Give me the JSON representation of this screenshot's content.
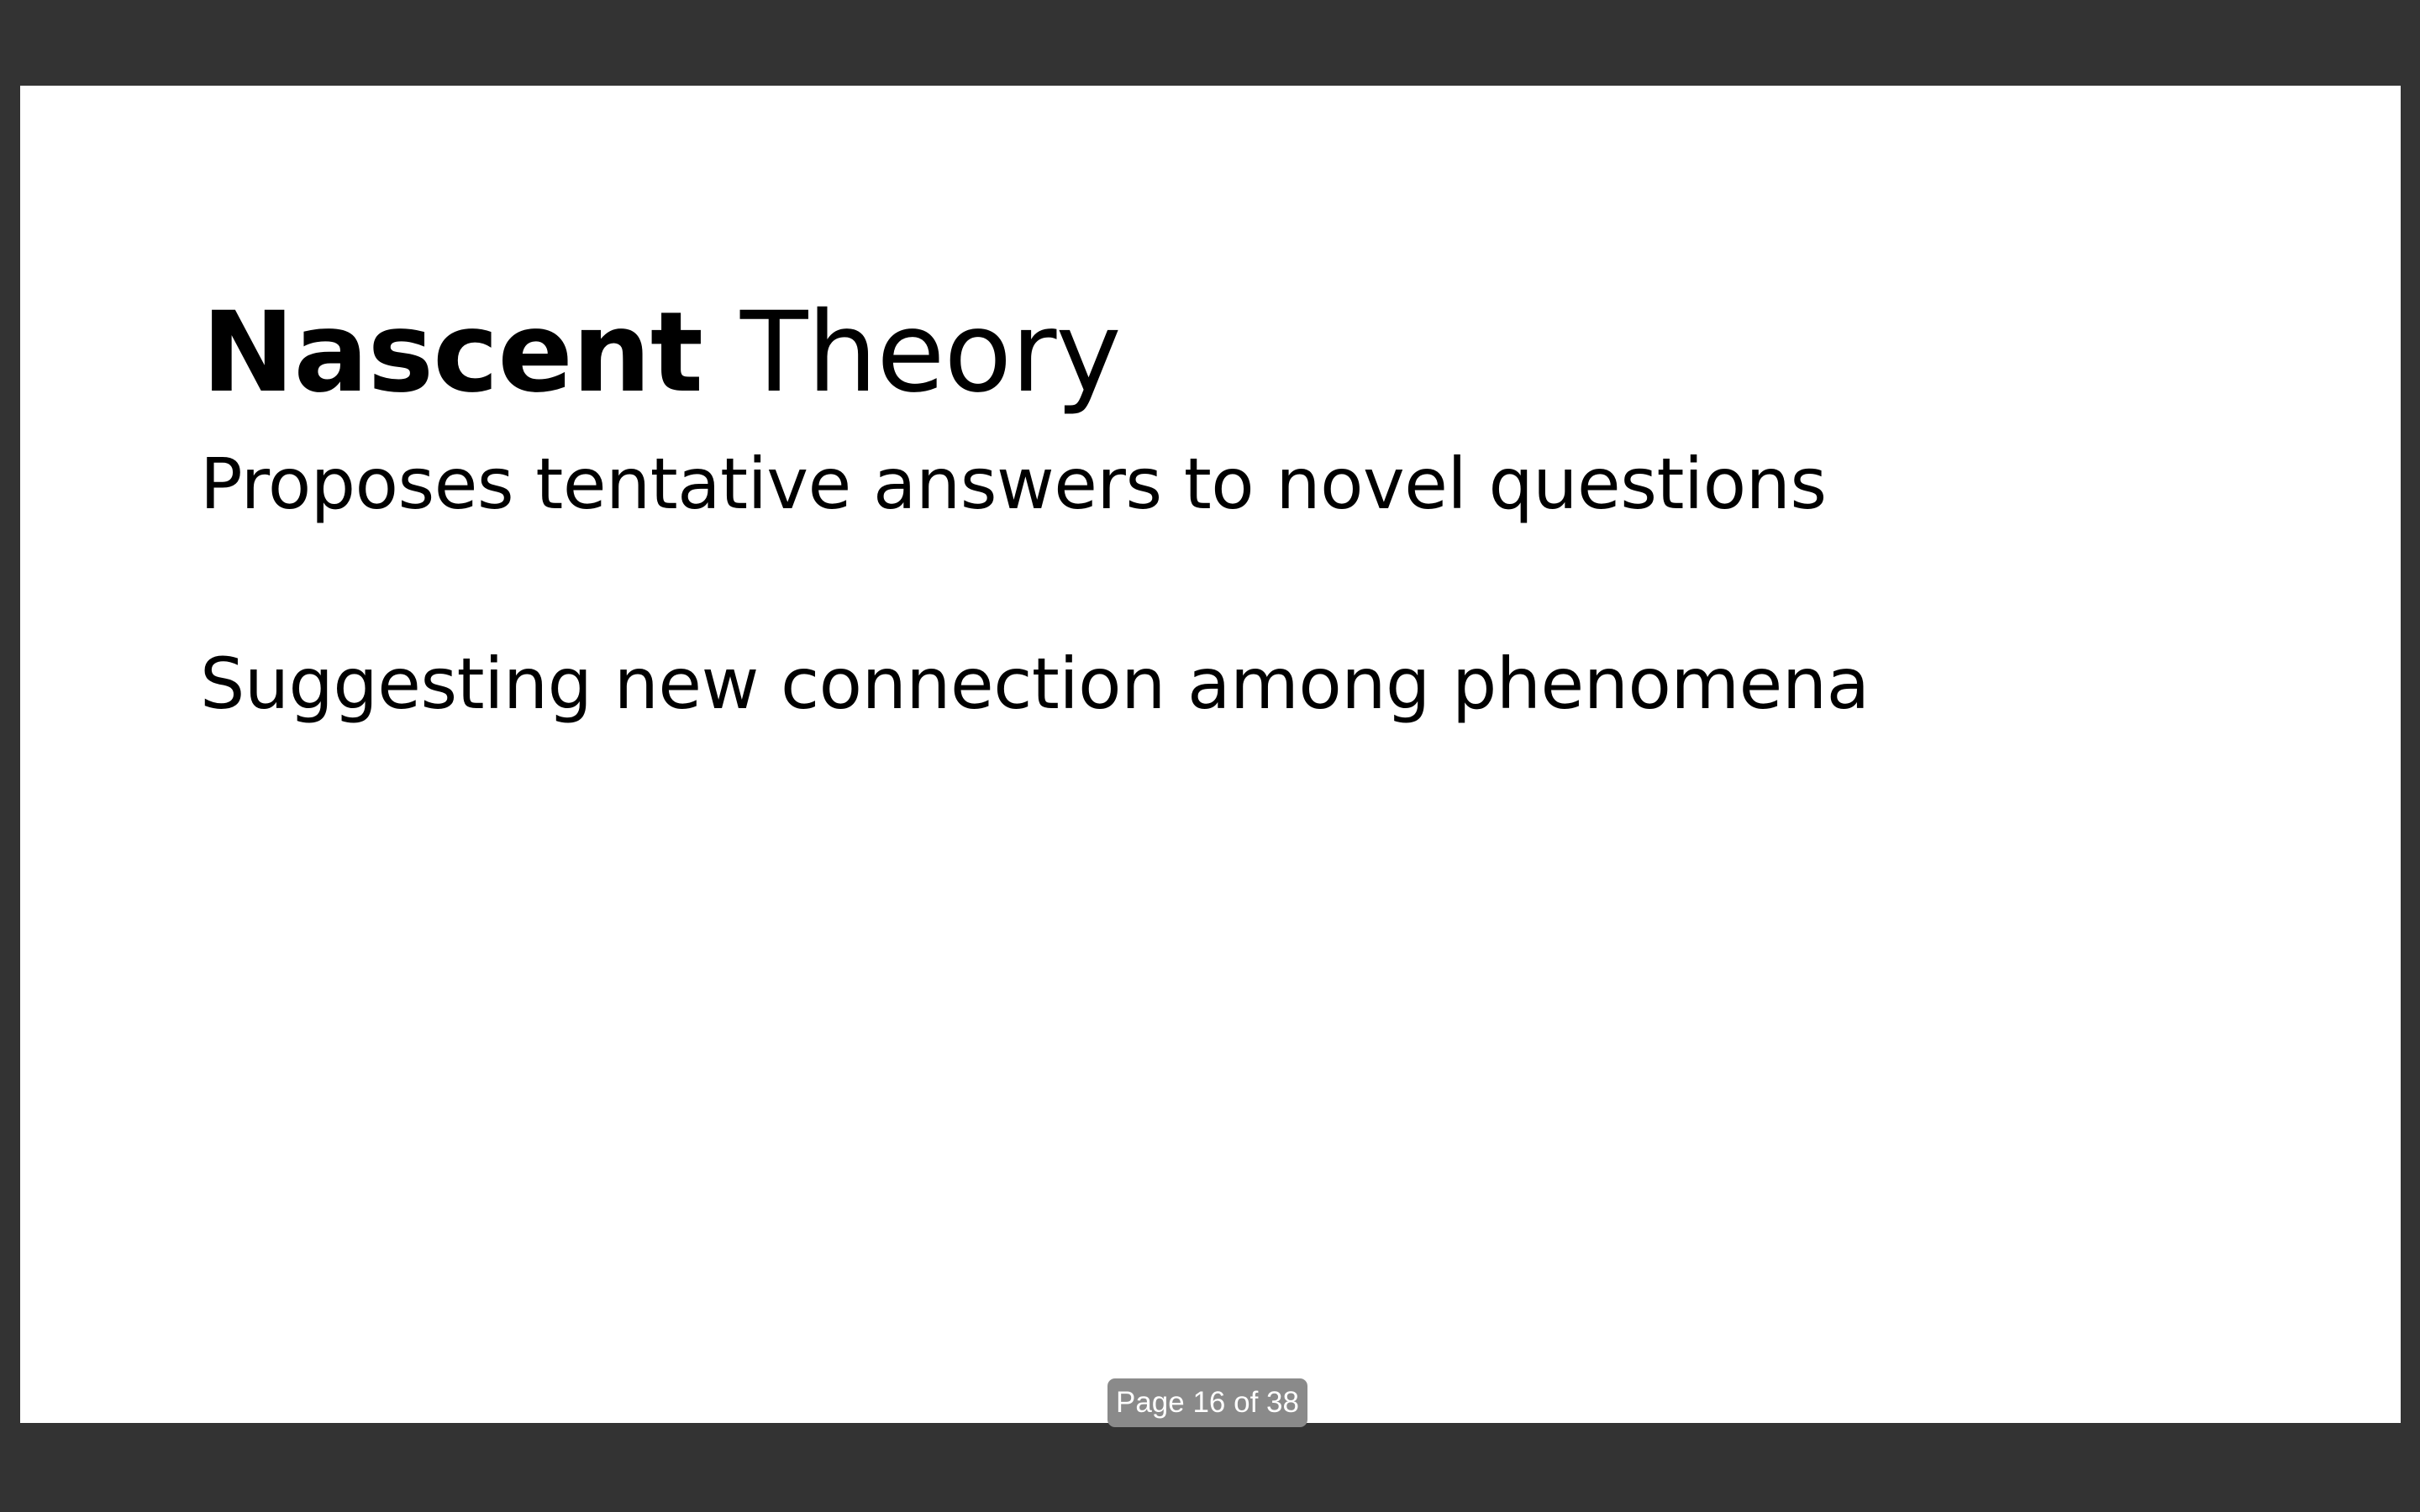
{
  "slide": {
    "title_bold": "Nascent",
    "title_regular": "Theory",
    "bullets": [
      "Proposes tentative answers to novel questions",
      "Suggesting new connection among phenomena"
    ]
  },
  "viewer": {
    "page_indicator": "Page 16 of 38",
    "background_color": "#333333",
    "badge_color": "#8a8a8a"
  }
}
